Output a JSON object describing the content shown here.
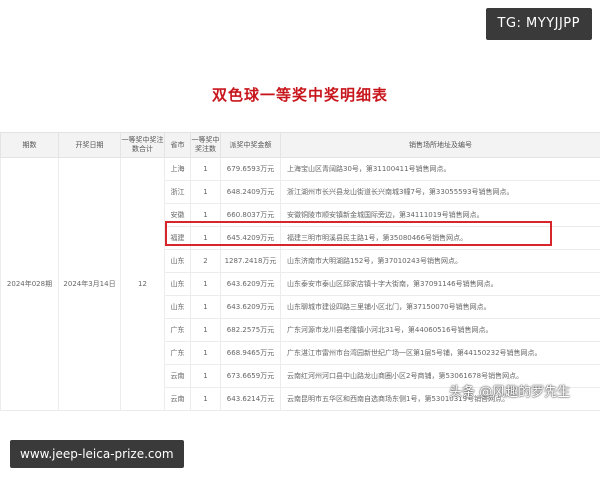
{
  "badges": {
    "tg": "TG: MYYJJPP",
    "site": "www.jeep-leica-prize.com"
  },
  "document": {
    "title": "双色球一等奖中奖明细表",
    "columns": [
      "期数",
      "开奖日期",
      "一等奖中奖注数合计",
      "省市",
      "一等奖中奖注数",
      "派奖中奖金额",
      "销售场所地址及编号"
    ],
    "issue": "2024年028期",
    "date": "2024年3月14日",
    "total_count": "12",
    "rows": [
      {
        "province": "上海",
        "count": "1",
        "amount": "679.6593万元",
        "address": "上海宝山区青阔路30号，第31100411号销售网点。"
      },
      {
        "province": "浙江",
        "count": "1",
        "amount": "648.2409万元",
        "address": "浙江湖州市长兴县龙山街道长兴南城3幢7号，第33055593号销售网点。"
      },
      {
        "province": "安徽",
        "count": "1",
        "amount": "660.8037万元",
        "address": "安徽铜陵市顺安镇新金城国际旁边，第34111019号销售网点。"
      },
      {
        "province": "福建",
        "count": "1",
        "amount": "645.4209万元",
        "address": "福建三明市明溪县民主路1号，第35080466号销售网点。"
      },
      {
        "province": "山东",
        "count": "2",
        "amount": "1287.2418万元",
        "address": "山东济南市大明湖路152号，第37010243号销售网点。"
      },
      {
        "province": "山东",
        "count": "1",
        "amount": "643.6209万元",
        "address": "山东泰安市泰山区邱家店镇十字大街南，第37091146号销售网点。"
      },
      {
        "province": "山东",
        "count": "1",
        "amount": "643.6209万元",
        "address": "山东聊城市建设四路三里铺小区北门，第37150070号销售网点。"
      },
      {
        "province": "广东",
        "count": "1",
        "amount": "682.2575万元",
        "address": "广东河源市龙川县老隆镇小河北31号，第44060516号销售网点。"
      },
      {
        "province": "广东",
        "count": "1",
        "amount": "668.9465万元",
        "address": "广东湛江市雷州市台湾园新世纪广场一区第1层5号铺，第44150232号销售网点。"
      },
      {
        "province": "云南",
        "count": "1",
        "amount": "673.6659万元",
        "address": "云南红河州河口县中山路龙山商圈小区2号商铺，第53061678号销售网点。"
      },
      {
        "province": "云南",
        "count": "1",
        "amount": "643.6214万元",
        "address": "云南昆明市五华区和西南自选商场东侧1号，第53010319号销售网点。"
      }
    ]
  },
  "watermark": "头条 @风趣的罗先生"
}
